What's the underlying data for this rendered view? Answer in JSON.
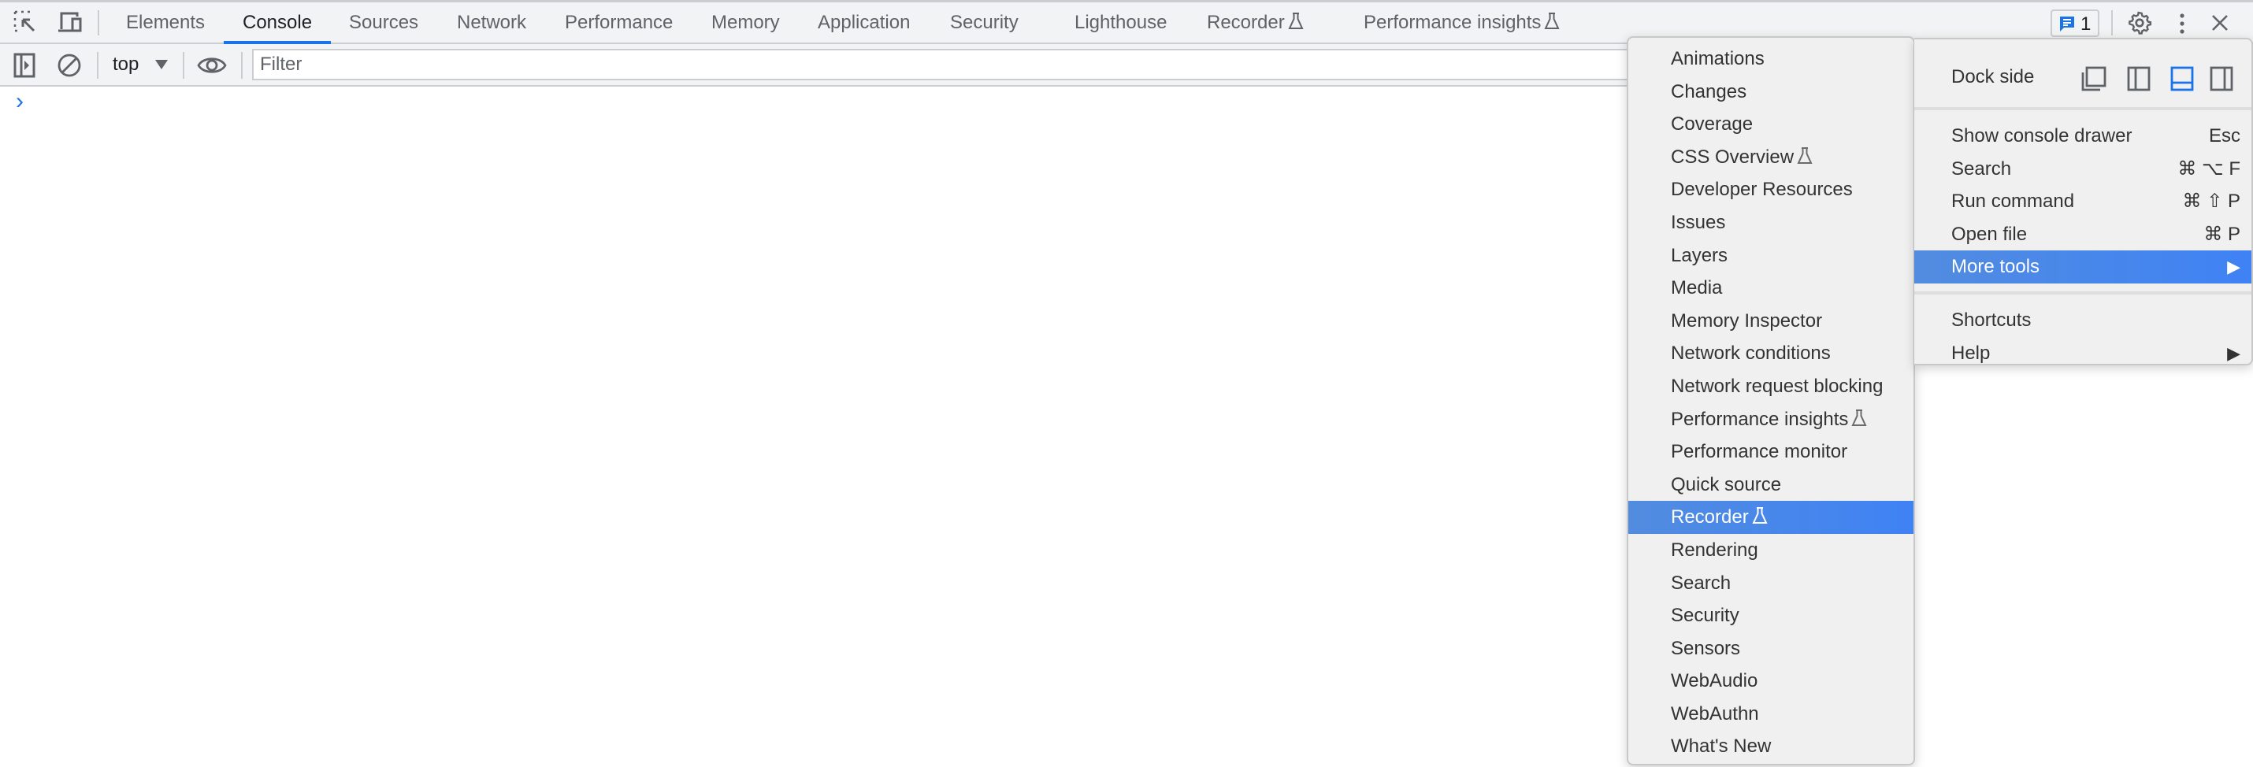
{
  "tabs": [
    {
      "label": "Elements",
      "active": false
    },
    {
      "label": "Console",
      "active": true
    },
    {
      "label": "Sources",
      "active": false
    },
    {
      "label": "Network",
      "active": false
    },
    {
      "label": "Performance",
      "active": false
    },
    {
      "label": "Memory",
      "active": false
    },
    {
      "label": "Application",
      "active": false
    },
    {
      "label": "Security",
      "active": false
    },
    {
      "label": "Lighthouse",
      "active": false
    },
    {
      "label": "Recorder",
      "active": false,
      "experimental": true
    },
    {
      "label": "Performance insights",
      "active": false,
      "experimental": true
    }
  ],
  "issues_count": "1",
  "toolbar": {
    "context": "top",
    "filter_placeholder": "Filter"
  },
  "console": {
    "prompt": "›"
  },
  "main_menu": {
    "dock_side_label": "Dock side",
    "dock_options": [
      "undock",
      "dock-left",
      "dock-bottom",
      "dock-right"
    ],
    "dock_selected": "dock-bottom",
    "items": [
      {
        "label": "Show console drawer",
        "shortcut": "Esc"
      },
      {
        "label": "Search",
        "shortcut": "⌘ ⌥ F"
      },
      {
        "label": "Run command",
        "shortcut": "⌘ ⇧ P"
      },
      {
        "label": "Open file",
        "shortcut": "⌘ P"
      },
      {
        "label": "More tools",
        "submenu": true,
        "highlighted": true
      }
    ],
    "items2": [
      {
        "label": "Shortcuts"
      },
      {
        "label": "Help",
        "submenu": true
      }
    ]
  },
  "more_tools": [
    {
      "label": "Animations"
    },
    {
      "label": "Changes"
    },
    {
      "label": "Coverage"
    },
    {
      "label": "CSS Overview",
      "experimental": true
    },
    {
      "label": "Developer Resources"
    },
    {
      "label": "Issues"
    },
    {
      "label": "Layers"
    },
    {
      "label": "Media"
    },
    {
      "label": "Memory Inspector"
    },
    {
      "label": "Network conditions"
    },
    {
      "label": "Network request blocking"
    },
    {
      "label": "Performance insights",
      "experimental": true
    },
    {
      "label": "Performance monitor"
    },
    {
      "label": "Quick source"
    },
    {
      "label": "Recorder",
      "experimental": true,
      "highlighted": true
    },
    {
      "label": "Rendering"
    },
    {
      "label": "Search"
    },
    {
      "label": "Security"
    },
    {
      "label": "Sensors"
    },
    {
      "label": "WebAudio"
    },
    {
      "label": "WebAuthn"
    },
    {
      "label": "What's New"
    }
  ],
  "colors": {
    "accent": "#1a73e8",
    "highlight": "#4285f4",
    "menu_bg": "#f0f0f0",
    "toolbar_bg": "#f1f3f4"
  }
}
